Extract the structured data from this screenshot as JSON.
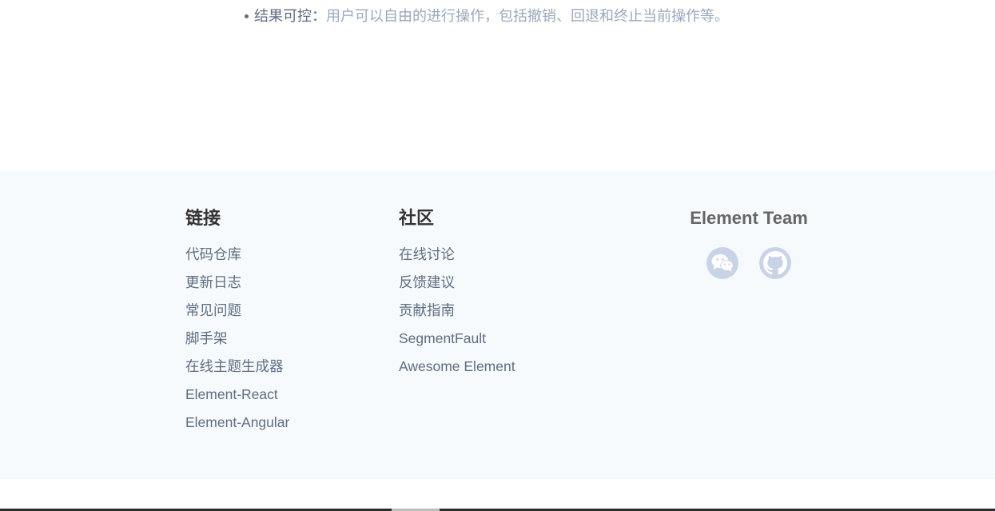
{
  "intro": {
    "bullet_label": "结果可控：",
    "bullet_desc": "用户可以自由的进行操作，包括撤销、回退和终止当前操作等。"
  },
  "footer": {
    "links": {
      "heading": "链接",
      "items": [
        "代码仓库",
        "更新日志",
        "常见问题",
        "脚手架",
        "在线主题生成器",
        "Element-React",
        "Element-Angular"
      ]
    },
    "community": {
      "heading": "社区",
      "items": [
        "在线讨论",
        "反馈建议",
        "贡献指南",
        "SegmentFault",
        "Awesome Element"
      ]
    },
    "team": {
      "title": "Element Team",
      "icons": [
        "wechat-icon",
        "github-icon"
      ]
    }
  },
  "colors": {
    "footer_bg": "#f7fafc",
    "heading": "#333333",
    "link_text": "#5e6d82",
    "desc_text": "#99a9bf",
    "social_icon": "#c8d4e6"
  }
}
